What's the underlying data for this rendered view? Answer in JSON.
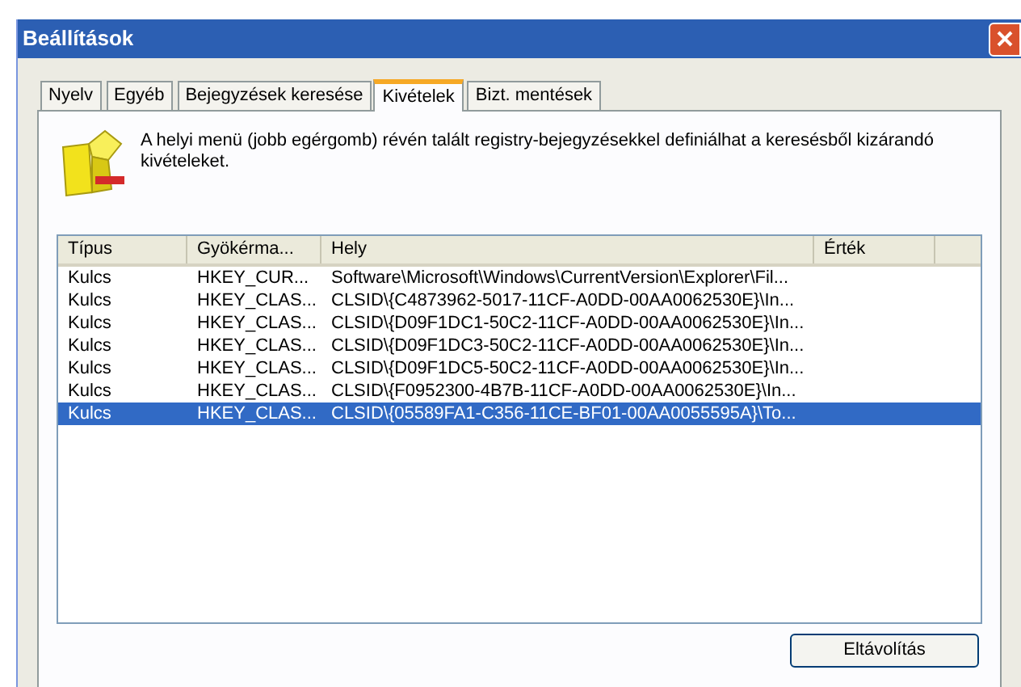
{
  "window": {
    "title": "Beállítások"
  },
  "tabs": [
    {
      "label": "Nyelv",
      "selected": false
    },
    {
      "label": "Egyéb",
      "selected": false
    },
    {
      "label": "Bejegyzések keresése",
      "selected": false
    },
    {
      "label": "Kivételek",
      "selected": true
    },
    {
      "label": "Bizt. mentések",
      "selected": false
    }
  ],
  "description": "A helyi menü (jobb egérgomb) révén talált registry-bejegyzésekkel definiálhat a keresésből kizárandó kivételeket.",
  "table": {
    "columns": [
      "Típus",
      "Gyökérma...",
      "Hely",
      "Érték"
    ],
    "rows": [
      {
        "cells": [
          "Kulcs",
          "HKEY_CUR...",
          "Software\\Microsoft\\Windows\\CurrentVersion\\Explorer\\Fil..."
        ],
        "selected": false
      },
      {
        "cells": [
          "Kulcs",
          "HKEY_CLAS...",
          "CLSID\\{C4873962-5017-11CF-A0DD-00AA0062530E}\\In..."
        ],
        "selected": false
      },
      {
        "cells": [
          "Kulcs",
          "HKEY_CLAS...",
          "CLSID\\{D09F1DC1-50C2-11CF-A0DD-00AA0062530E}\\In..."
        ],
        "selected": false
      },
      {
        "cells": [
          "Kulcs",
          "HKEY_CLAS...",
          "CLSID\\{D09F1DC3-50C2-11CF-A0DD-00AA0062530E}\\In..."
        ],
        "selected": false
      },
      {
        "cells": [
          "Kulcs",
          "HKEY_CLAS...",
          "CLSID\\{D09F1DC5-50C2-11CF-A0DD-00AA0062530E}\\In..."
        ],
        "selected": false
      },
      {
        "cells": [
          "Kulcs",
          "HKEY_CLAS...",
          "CLSID\\{F0952300-4B7B-11CF-A0DD-00AA0062530E}\\In..."
        ],
        "selected": false
      },
      {
        "cells": [
          "Kulcs",
          "HKEY_CLAS...",
          "CLSID\\{05589FA1-C356-11CE-BF01-00AA0055595A}\\To..."
        ],
        "selected": true
      }
    ]
  },
  "buttons": [
    "Eltávolítás"
  ]
}
